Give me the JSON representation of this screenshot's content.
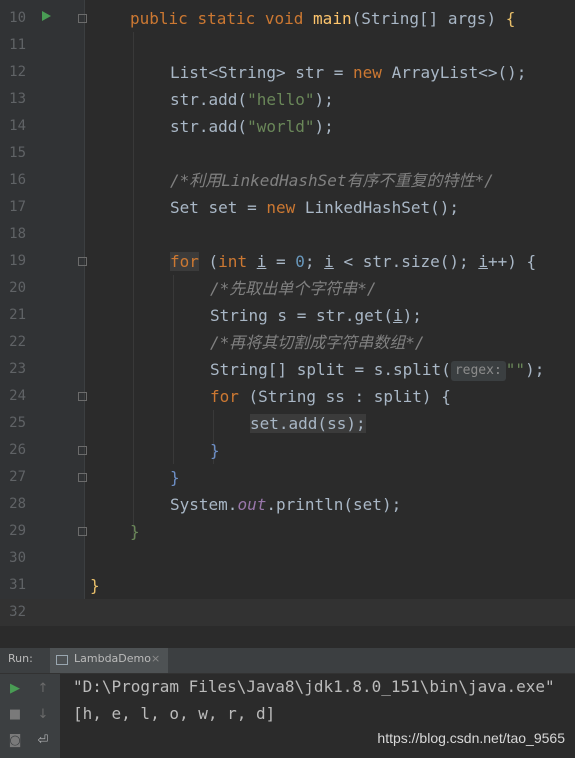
{
  "editor": {
    "line_numbers": [
      "10",
      "11",
      "12",
      "13",
      "14",
      "15",
      "16",
      "17",
      "18",
      "19",
      "20",
      "21",
      "22",
      "23",
      "24",
      "25",
      "26",
      "27",
      "28",
      "29",
      "30",
      "31",
      "32"
    ],
    "lines": {
      "l10": {
        "kw1": "public",
        "kw2": "static",
        "kw3": "void",
        "fn": "main",
        "rest": "(String[] args) ",
        "brace": "{"
      },
      "l12": {
        "a": "List<String> str = ",
        "kw": "new",
        "b": " ArrayList<>();"
      },
      "l13": {
        "a": "str.add(",
        "s": "\"hello\"",
        "b": ");"
      },
      "l14": {
        "a": "str.add(",
        "s": "\"world\"",
        "b": ");"
      },
      "l16": {
        "c": "/*利用LinkedHashSet有序不重复的特性*/"
      },
      "l17": {
        "a": "Set set = ",
        "kw": "new",
        "b": " LinkedHashSet();"
      },
      "l19": {
        "kw": "for",
        "a": " (",
        "kw2": "int",
        "v": "i",
        "b": " = ",
        "n": "0",
        "c": "; ",
        "v2": "i",
        "d": " < str.size(); ",
        "v3": "i",
        "e": "++) {"
      },
      "l20": {
        "c": "/*先取出单个字符串*/"
      },
      "l21": {
        "a": "String s = str.get(",
        "v": "i",
        "b": ");"
      },
      "l22": {
        "c": "/*再将其切割成字符串数组*/"
      },
      "l23": {
        "a": "String[] split = s.split(",
        "hint": "regex:",
        "s": "\"\"",
        "b": ");"
      },
      "l24": {
        "kw": "for",
        "a": " (String ss : split) {"
      },
      "l25": {
        "a": "set.add(ss);"
      },
      "l26": {
        "a": "}"
      },
      "l27": {
        "a": "}"
      },
      "l28": {
        "a": "System.",
        "f": "out",
        "b": ".println(set);"
      },
      "l29": {
        "a": "}"
      },
      "l31": {
        "a": "}"
      }
    }
  },
  "run_panel": {
    "label": "Run:",
    "tab_name": "LambdaDemo",
    "tab_close": "×",
    "console_lines": [
      "\"D:\\Program Files\\Java8\\jdk1.8.0_151\\bin\\java.exe\"",
      "[h, e, l, o, w, r, d]"
    ],
    "icons": [
      "run-icon",
      "stop-icon",
      "camera-icon",
      "up-icon",
      "down-icon",
      "wrap-icon"
    ]
  },
  "watermark": "https://blog.csdn.net/tao_9565",
  "colors": {
    "background": "#2b2b2b",
    "keyword": "#cc7832",
    "string": "#6a8759",
    "comment": "#808080",
    "number": "#6897bb",
    "method": "#ffc66d"
  }
}
